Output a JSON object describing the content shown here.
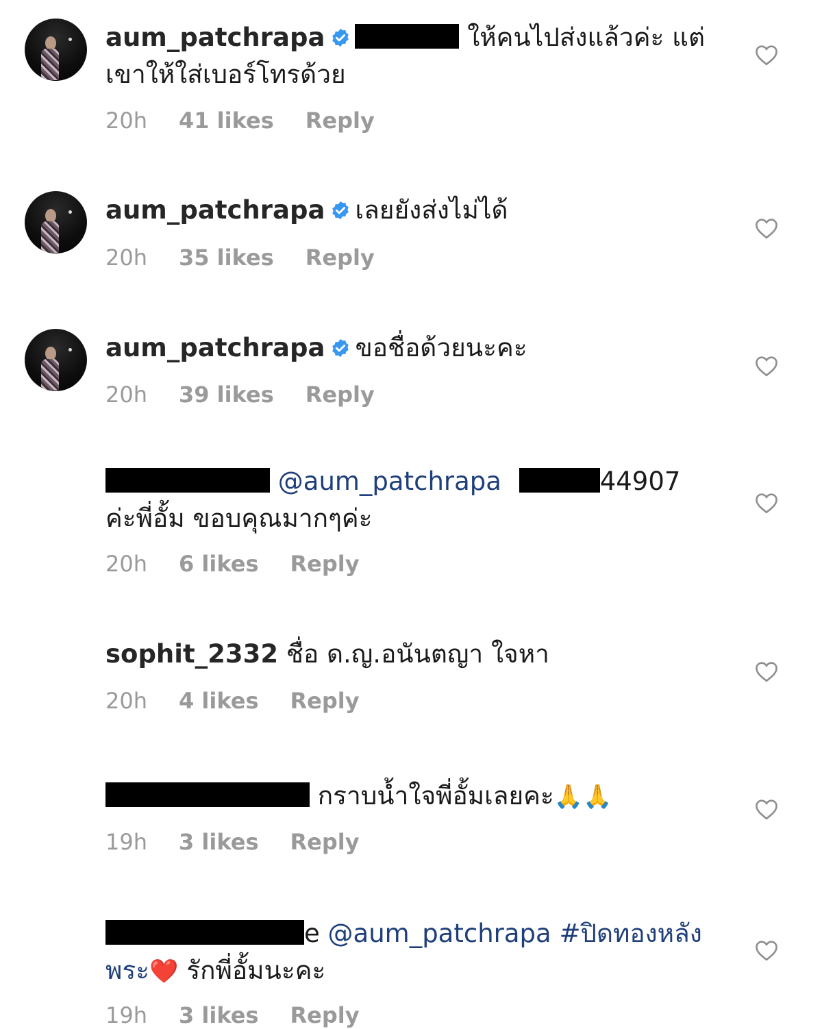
{
  "comments": [
    {
      "username": "aum_patchrapa",
      "verified": true,
      "line1": "ให้คนไปส่งแล้วค่ะ แต่",
      "line2": "เขาให้ใส่เบอร์โทรด้วย",
      "time": "20h",
      "likes": "41 likes",
      "reply": "Reply"
    },
    {
      "username": "aum_patchrapa",
      "verified": true,
      "line1": "เลยยังส่งไม่ได้",
      "time": "20h",
      "likes": "35 likes",
      "reply": "Reply"
    },
    {
      "username": "aum_patchrapa",
      "verified": true,
      "line1": "ขอชื่อด้วยนะคะ",
      "time": "20h",
      "likes": "39 likes",
      "reply": "Reply"
    },
    {
      "mention": "@aum_patchrapa",
      "phone_suffix": "44907",
      "line2": "ค่ะพี่อั้ม ขอบคุณมากๆค่ะ",
      "time": "20h",
      "likes": "6 likes",
      "reply": "Reply"
    },
    {
      "username": "sophit_2332",
      "line1": "ชื่อ ด.ญ.อนันตญา ใจหา",
      "time": "20h",
      "likes": "4 likes",
      "reply": "Reply"
    },
    {
      "line1": "กราบน้ำใจพี่อั้มเลยคะ",
      "emoji": "🙏🙏",
      "time": "19h",
      "likes": "3 likes",
      "reply": "Reply"
    },
    {
      "username_tail": "e",
      "mention": "@aum_patchrapa",
      "hashtag": "#ปิดทองหลัง",
      "hashtag_cont": "พระ",
      "heart_emoji": "❤️",
      "line2": "รักพี่อั้มนะคะ",
      "time": "19h",
      "likes": "3 likes",
      "reply": "Reply"
    }
  ]
}
